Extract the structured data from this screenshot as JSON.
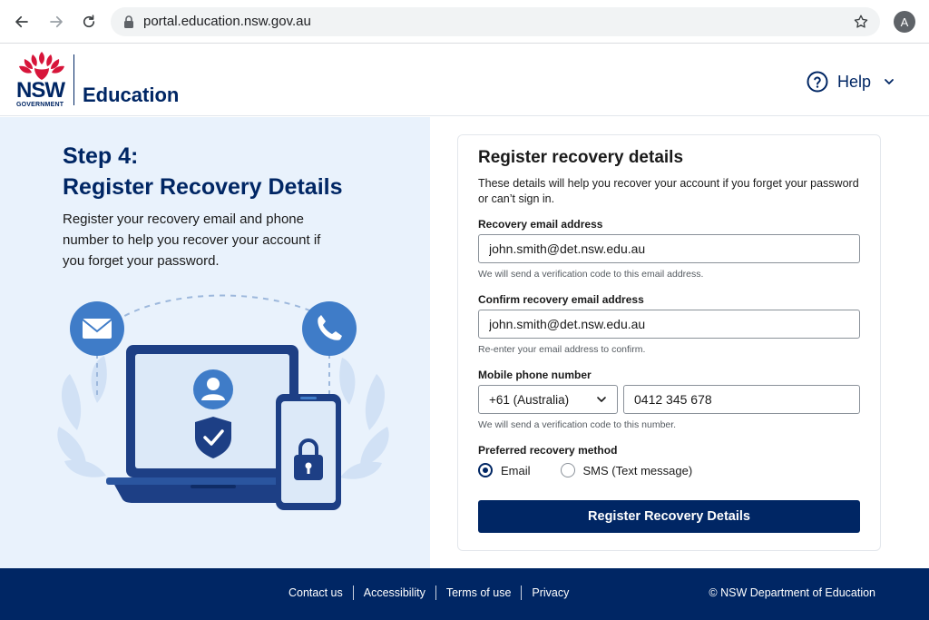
{
  "browser": {
    "url": "portal.education.nsw.gov.au",
    "profile_initial": "A"
  },
  "header": {
    "logo_text": "NSW",
    "logo_subtext": "GOVERNMENT",
    "brand": "Education",
    "help_label": "Help"
  },
  "left": {
    "step_title_line1": "Step 4:",
    "step_title_line2": "Register Recovery Details",
    "description": "Register your recovery email and phone number to help you recover your account if you forget your password."
  },
  "form": {
    "title": "Register recovery details",
    "description": "These details will help you recover your account if you forget your password or can’t sign in.",
    "email_label": "Recovery email address",
    "email_value": "john.smith@det.nsw.edu.au",
    "email_hint": "We will send a verification code to this email address.",
    "confirm_label": "Confirm recovery email address",
    "confirm_value": "john.smith@det.nsw.edu.au",
    "confirm_hint": "Re-enter your email address to confirm.",
    "phone_label": "Mobile phone number",
    "country_value": "+61 (Australia)",
    "phone_value": "0412 345 678",
    "phone_hint": "We will send a verification code to this number.",
    "method_label": "Preferred recovery method",
    "method_options": [
      {
        "label": "Email",
        "checked": true
      },
      {
        "label": "SMS (Text message)",
        "checked": false
      }
    ],
    "submit_label": "Register Recovery Details"
  },
  "footer": {
    "links": [
      "Contact us",
      "Accessibility",
      "Terms of use",
      "Privacy"
    ],
    "copyright": "© NSW Department of Education"
  },
  "colors": {
    "brand_navy": "#002664",
    "accent_blue": "#3f7cc8",
    "panel_bg": "#e9f2fc",
    "waratah_red": "#d7153a"
  }
}
